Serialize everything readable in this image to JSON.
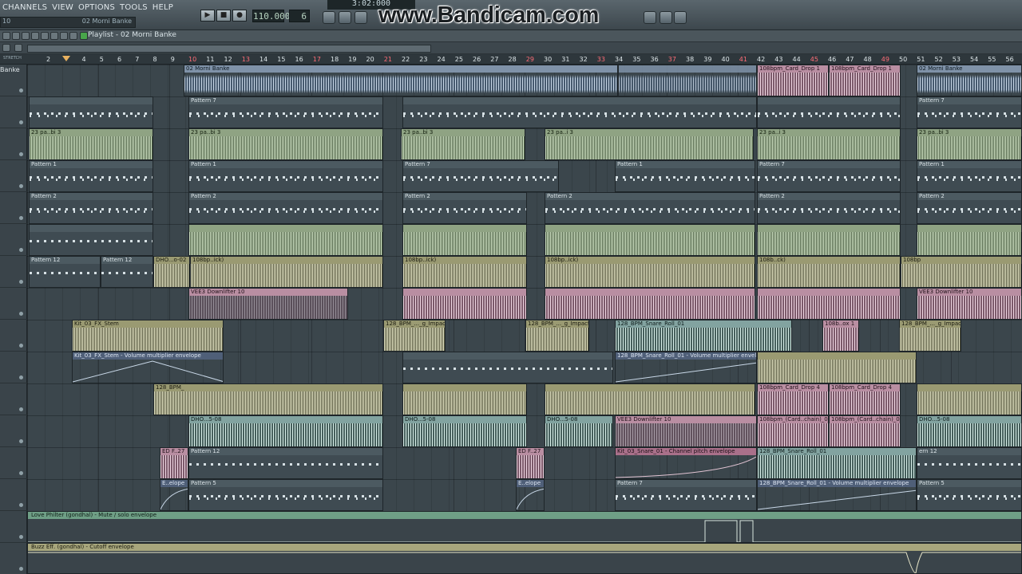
{
  "menu": [
    "CHANNELS",
    "VIEW",
    "OPTIONS",
    "TOOLS",
    "HELP"
  ],
  "hint": {
    "left": "10",
    "right": "02 Morni Banke"
  },
  "transport": {
    "tempo": "110.000",
    "pattern": "6",
    "clock": "3:02:000"
  },
  "watermark": "www.Bandicam.com",
  "playlist": {
    "title": "Playlist - 02 Morni Banke",
    "ruler_label": "STRETCH"
  },
  "ruler": {
    "white": [
      "2",
      "4",
      "5",
      "6",
      "7",
      "8",
      "9",
      "11",
      "12",
      "14",
      "15",
      "16",
      "18",
      "19",
      "20",
      "22",
      "23",
      "24",
      "25",
      "26",
      "27",
      "28",
      "30",
      "31",
      "32",
      "34",
      "35",
      "36",
      "38",
      "39",
      "40",
      "42",
      "43",
      "44",
      "46",
      "47",
      "48",
      "50",
      "51",
      "52",
      "53",
      "54",
      "55",
      "56"
    ],
    "red": [
      "10",
      "13",
      "17",
      "21",
      "29",
      "33",
      "37",
      "41",
      "45",
      "49"
    ]
  },
  "tracks": {
    "track1": "Banke"
  },
  "clips": {
    "t1a": "02 Morni Banke",
    "t1b": "108bpm_Card_Drop 1",
    "t1c": "108bpm_Card_Drop 1",
    "t1d": "02 Morni Banke",
    "pat7": "Pattern 7",
    "pat1": "Pattern 1",
    "pat2": "Pattern 2",
    "pat12": "Pattern 12",
    "pat5": "Pattern 5",
    "pa23": "23 pa..bi 3",
    "pa23b": "23 pa..bi 3",
    "pa23c": "23 pa..i 3",
    "pa23d": "23 pa..i 3",
    "dho02": "DHO...o-02",
    "b108": "108bp..ick)",
    "b108b": "108bp..ick)",
    "b108c": "108b..ck)",
    "b108d": "108bp",
    "vee3": "VEE3 Downlifter 10",
    "vee3b": "VEE3 Downlifter 10",
    "vee3c": "VEE3 Downlifter 10",
    "kit3": "Kit_03_FX_Stem",
    "kit3env": "Kit_03_FX_Stem - Volume multiplier envelope",
    "impact": "128_BPM_..._g_Impact",
    "impact2": "128_BPM_..._g_Impact",
    "impact3": "128_BPM_..._g_Impact",
    "snareroll": "128_BPM_Snare_Roll_01",
    "snarerollenv": "128_BPM_Snare_Roll_01 - Volume multiplier envelope",
    "box1": "108b..ox 1",
    "bpm128": "128_BPM_",
    "card4": "108bpm_Card_Drop 4",
    "card4b": "108bpm_Card_Drop 4",
    "dho508": "DHO...5-08",
    "cardchain": "108bpm_(Card..chain)_01",
    "cardchainb": "108bpm_(Card..chain)_01",
    "edf": "ED F..27",
    "edf2": "ED F..27",
    "eelope": "E..elope",
    "eelope2": "E..elope",
    "kitsnare": "Kit_03_Snare_01 - Channel pitch envelope",
    "snareroll2": "128_BPM_Snare_Roll_01",
    "snareroll2env": "128_BPM_Snare_Roll_01 - Volume multiplier envelope",
    "ern12": "ern 12"
  },
  "envelopes": {
    "lovephilter": "Love Philter (gondhal) - Mute / solo envelope",
    "buzz": "Buzz Eff. (gondhal) - Cutoff envelope"
  }
}
